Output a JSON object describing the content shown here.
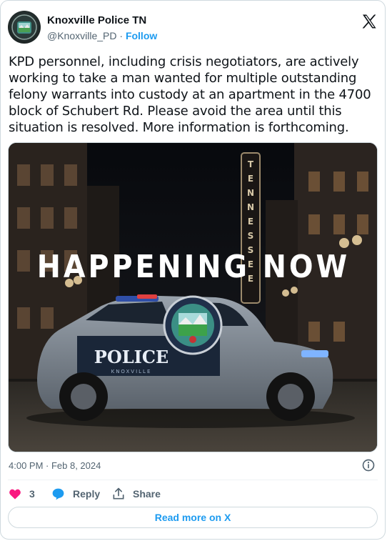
{
  "author": {
    "name": "Knoxville Police TN",
    "handle": "@Knoxville_PD",
    "separator": "·",
    "follow_label": "Follow"
  },
  "tweet": {
    "text": "KPD personnel, including crisis negotiators, are actively working to take a man wanted for multiple outstanding felony warrants into custody at an apartment in the 4700 block of Schubert Rd. Please avoid the area until this situation is resolved. More information is forthcoming."
  },
  "media": {
    "headline": "HAPPENING NOW",
    "vertical_sign": "TENNESSEE",
    "car_door_text": "POLICE",
    "car_lower_text": "KNOXVILLE"
  },
  "meta": {
    "timestamp": "4:00 PM · Feb 8, 2024"
  },
  "actions": {
    "like_count": "3",
    "reply_label": "Reply",
    "share_label": "Share"
  },
  "footer": {
    "read_more_label": "Read more on X"
  },
  "icons": {
    "brand": "x-logo",
    "info": "info-icon",
    "like": "heart-icon",
    "reply": "speech-bubble-icon",
    "share": "share-upload-icon"
  },
  "colors": {
    "like": "#f91880",
    "reply": "#1d9bf0",
    "link": "#1d9bf0",
    "muted": "#536471",
    "border": "#cfd9de"
  }
}
